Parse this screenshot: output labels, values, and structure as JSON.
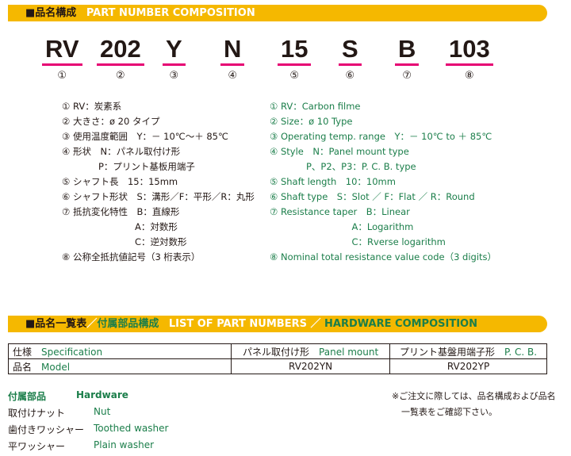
{
  "section1": {
    "prefix": "■",
    "title_jp": "品名構成",
    "title_en": "PART NUMBER COMPOSITION"
  },
  "code_parts": [
    {
      "text": "RV",
      "num": "①"
    },
    {
      "text": "202",
      "num": "②"
    },
    {
      "text": "Y",
      "num": "③"
    },
    {
      "text": "N",
      "num": "④"
    },
    {
      "text": "15",
      "num": "⑤"
    },
    {
      "text": "S",
      "num": "⑥"
    },
    {
      "text": "B",
      "num": "⑦"
    },
    {
      "text": "103",
      "num": "⑧"
    }
  ],
  "jp_lines": [
    "① RV：炭素系",
    "② 大きさ：ø 20 タイプ",
    "③ 使用温度範囲　Y：－ 10℃〜＋ 85℃",
    "④ 形状　N：パネル取付け形",
    "　　　　P：プリント基板用端子",
    "⑤ シャフト長　15：15mm",
    "⑥ シャフト形状　S：溝形／F：平形／R：丸形",
    "⑦ 抵抗変化特性　B：直線形",
    "　　　　　　　　A：対数形",
    "　　　　　　　　C：逆対数形",
    "⑧ 公称全抵抗値記号（3 桁表示）"
  ],
  "en_lines": [
    "① RV：Carbon filme",
    "② Size：ø 10 Type",
    "③ Operating temp. range　Y：－ 10℃ to ＋ 85℃",
    "④ Style　N：Panel mount type",
    "　　　　P、P2、P3：P. C. B. type",
    "⑤ Shaft length　10：10mm",
    "⑥ Shaft type　S：Slot ／ F：Flat ／ R：Round",
    "⑦ Resistance taper　B：Linear",
    "　　　　　　　　　A：Logarithm",
    "　　　　　　　　　C：Rverse logarithm",
    "⑧ Nominal total resistance value code（3 digits）"
  ],
  "section2": {
    "prefix": "■",
    "title_jp1": "品名一覧表",
    "slash": "／",
    "title_jp2": "付属部品構成",
    "title_en1": "LIST OF PART NUMBERS",
    "slash_en": "／",
    "title_en2": "HARDWARE COMPOSITION"
  },
  "table": {
    "row1": {
      "label_jp": "仕様",
      "label_en": "Specification",
      "col1_jp": "パネル取付け形",
      "col1_en": "Panel mount",
      "col2_jp": "プリント基盤用端子形",
      "col2_en": "P. C. B."
    },
    "row2": {
      "label_jp": "品名",
      "label_en": "Model",
      "col1": "RV202YN",
      "col2": "RV202YP"
    }
  },
  "hardware": {
    "title_jp": "付属部品",
    "title_en": "Hardware",
    "items": [
      {
        "jp": "取付けナット",
        "en": "Nut"
      },
      {
        "jp": "歯付きワッシャー",
        "en": "Toothed washer"
      },
      {
        "jp": "平ワッシャー",
        "en": "Plain washer"
      }
    ]
  },
  "note": {
    "line1": "※ご注文に際しては、品名構成および品名",
    "line2": "一覧表をご確認下さい。"
  },
  "colors": {
    "bar": "#f5b800",
    "green": "#1b7e4a",
    "underline": "#e60073"
  }
}
